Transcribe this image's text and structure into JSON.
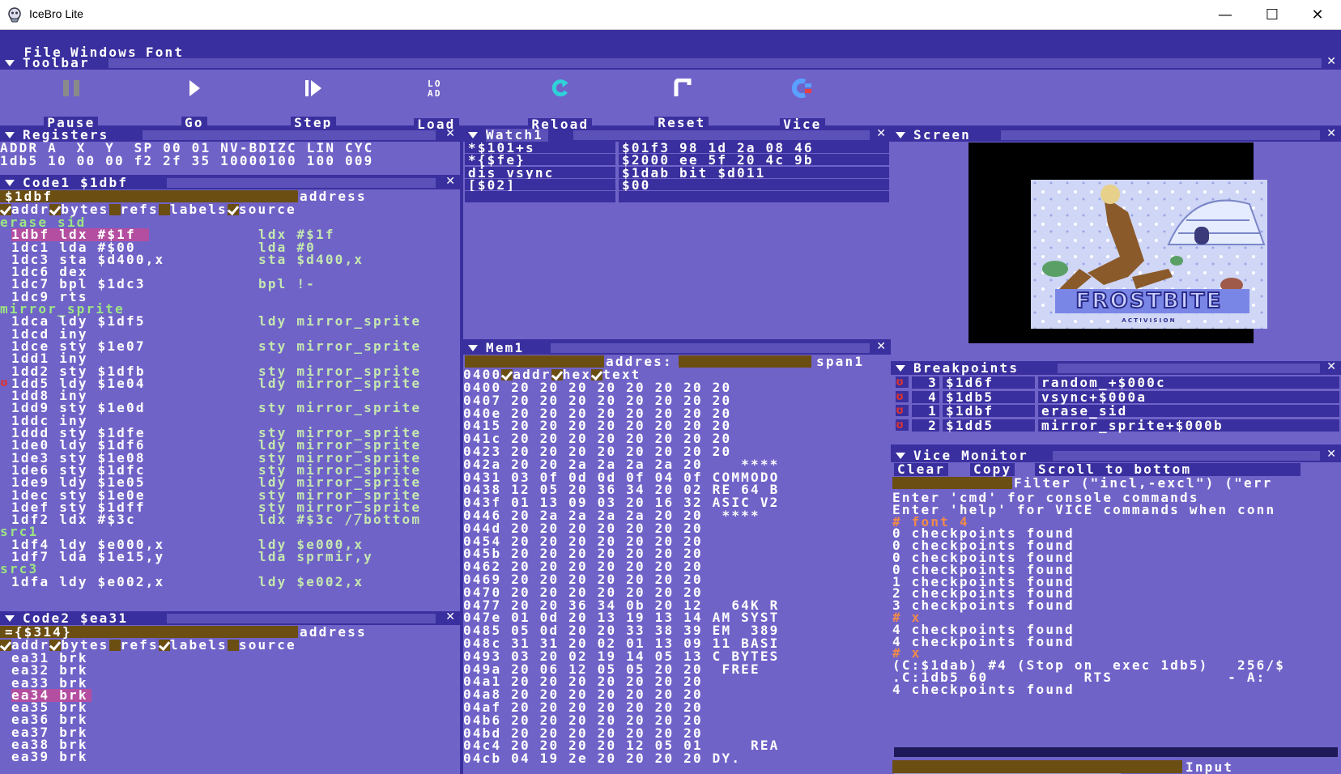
{
  "window": {
    "title": "IceBro Lite",
    "minimize": "—",
    "maximize": "☐",
    "close": "✕"
  },
  "menu": [
    "File",
    "Windows",
    "Font"
  ],
  "toolbar": {
    "title": "Toolbar",
    "buttons": [
      "Pause",
      "Go",
      "Step",
      "Load",
      "Reload",
      "Reset",
      "Vice"
    ]
  },
  "registers": {
    "title": "Registers",
    "header": "ADDR A  X  Y  SP 00 01 NV-BDIZC LIN CYC",
    "values": "1db5 10 00 00 f2 2f 35 10000100 100 009"
  },
  "code1": {
    "title": "Code1 $1dbf",
    "address_input": "$1dbf",
    "address_label": "address",
    "options": [
      {
        "label": "addr",
        "checked": true
      },
      {
        "label": "bytes",
        "checked": true
      },
      {
        "label": "refs",
        "checked": false
      },
      {
        "label": "labels",
        "checked": false
      },
      {
        "label": "source",
        "checked": true
      }
    ],
    "lines": [
      {
        "t": "label",
        "text": "erase_sid"
      },
      {
        "t": "pc",
        "addr": "1dbf",
        "ins": "ldx #$1f",
        "src": "ldx #$1f"
      },
      {
        "addr": "1dc1",
        "ins": "lda #$00",
        "src": "lda #0"
      },
      {
        "addr": "1dc3",
        "ins": "sta $d400,x",
        "src": "sta $d400,x"
      },
      {
        "addr": "1dc6",
        "ins": "dex",
        "src": ""
      },
      {
        "addr": "1dc7",
        "ins": "bpl $1dc3",
        "src": "bpl !-"
      },
      {
        "addr": "1dc9",
        "ins": "rts",
        "src": ""
      },
      {
        "t": "label",
        "text": "mirror_sprite"
      },
      {
        "addr": "1dca",
        "ins": "ldy $1df5",
        "src": "ldy mirror_sprite"
      },
      {
        "addr": "1dcd",
        "ins": "iny",
        "src": ""
      },
      {
        "addr": "1dce",
        "ins": "sty $1e07",
        "src": "sty mirror_sprite"
      },
      {
        "addr": "1dd1",
        "ins": "iny",
        "src": ""
      },
      {
        "addr": "1dd2",
        "ins": "sty $1dfb",
        "src": "sty mirror_sprite"
      },
      {
        "t": "bp",
        "addr": "1dd5",
        "ins": "ldy $1e04",
        "src": "ldy mirror_sprite"
      },
      {
        "addr": "1dd8",
        "ins": "iny",
        "src": ""
      },
      {
        "addr": "1dd9",
        "ins": "sty $1e0d",
        "src": "sty mirror_sprite"
      },
      {
        "addr": "1ddc",
        "ins": "iny",
        "src": ""
      },
      {
        "addr": "1ddd",
        "ins": "sty $1dfe",
        "src": "sty mirror_sprite"
      },
      {
        "addr": "1de0",
        "ins": "ldy $1df6",
        "src": "ldy mirror_sprite"
      },
      {
        "addr": "1de3",
        "ins": "sty $1e08",
        "src": "sty mirror_sprite"
      },
      {
        "addr": "1de6",
        "ins": "sty $1dfc",
        "src": "sty mirror_sprite"
      },
      {
        "addr": "1de9",
        "ins": "ldy $1e05",
        "src": "ldy mirror_sprite"
      },
      {
        "addr": "1dec",
        "ins": "sty $1e0e",
        "src": "sty mirror_sprite"
      },
      {
        "addr": "1def",
        "ins": "sty $1dff",
        "src": "sty mirror_sprite"
      },
      {
        "addr": "1df2",
        "ins": "ldx #$3c",
        "src": "ldx #$3c //bottom"
      },
      {
        "t": "label",
        "text": "src1"
      },
      {
        "addr": "1df4",
        "ins": "ldy $e000,x",
        "src": "ldy $e000,x"
      },
      {
        "addr": "1df7",
        "ins": "lda $1e15,y",
        "src": "lda sprmir,y"
      },
      {
        "t": "label",
        "text": "src3"
      },
      {
        "addr": "1dfa",
        "ins": "ldy $e002,x",
        "src": "ldy $e002,x"
      }
    ]
  },
  "code2": {
    "title": "Code2 $ea31",
    "address_input": "={$314}",
    "address_label": "address",
    "options": [
      {
        "label": "addr",
        "checked": true
      },
      {
        "label": "bytes",
        "checked": true
      },
      {
        "label": "refs",
        "checked": false
      },
      {
        "label": "labels",
        "checked": true
      },
      {
        "label": "source",
        "checked": false
      }
    ],
    "lines": [
      {
        "addr": "ea31",
        "ins": "brk"
      },
      {
        "addr": "ea32",
        "ins": "brk"
      },
      {
        "addr": "ea33",
        "ins": "brk"
      },
      {
        "t": "pc",
        "addr": "ea34",
        "ins": "brk"
      },
      {
        "addr": "ea35",
        "ins": "brk"
      },
      {
        "addr": "ea36",
        "ins": "brk"
      },
      {
        "addr": "ea37",
        "ins": "brk"
      },
      {
        "addr": "ea38",
        "ins": "brk"
      },
      {
        "addr": "ea39",
        "ins": "brk"
      }
    ]
  },
  "watch": {
    "title": "Watch1",
    "rows": [
      {
        "expr": "*$101+s",
        "value": "$01f3 98 1d 2a 08 46"
      },
      {
        "expr": "*{$fe}",
        "value": "$2000 ee 5f 20 4c 9b"
      },
      {
        "expr": "dis vsync",
        "value": "$1dab bit $d011"
      },
      {
        "expr": "[$02]",
        "value": "$00"
      },
      {
        "expr": "",
        "value": ""
      }
    ]
  },
  "mem": {
    "title": "Mem1",
    "address_label": "addres:",
    "span_label": "span1",
    "start": "0400",
    "options": [
      {
        "label": "addr",
        "checked": true
      },
      {
        "label": "hex",
        "checked": true
      },
      {
        "label": "text",
        "checked": true
      }
    ],
    "rows": [
      "0400 20 20 20 20 20 20 20 20",
      "0407 20 20 20 20 20 20 20 20",
      "040e 20 20 20 20 20 20 20 20",
      "0415 20 20 20 20 20 20 20 20",
      "041c 20 20 20 20 20 20 20 20",
      "0423 20 20 20 20 20 20 20 20",
      "042a 20 20 2a 2a 2a 2a 20    ****",
      "0431 03 0f 0d 0d 0f 04 0f COMMODO",
      "0438 12 05 20 36 34 20 02 RE 64 B",
      "043f 01 13 09 03 20 16 32 ASIC V2",
      "0446 20 2a 2a 2a 2a 20 20  ****",
      "044d 20 20 20 20 20 20 20",
      "0454 20 20 20 20 20 20 20",
      "045b 20 20 20 20 20 20 20",
      "0462 20 20 20 20 20 20 20",
      "0469 20 20 20 20 20 20 20",
      "0470 20 20 20 20 20 20 20",
      "0477 20 20 36 34 0b 20 12   64K R",
      "047e 01 0d 20 13 19 13 14 AM SYST",
      "0485 05 0d 20 20 33 38 39 EM  389",
      "048c 31 31 20 02 01 13 09 11 BASI",
      "0493 03 20 02 19 14 05 13 C BYTES",
      "049a 20 06 12 05 05 20 20  FREE",
      "04a1 20 20 20 20 20 20 20",
      "04a8 20 20 20 20 20 20 20",
      "04af 20 20 20 20 20 20 20",
      "04b6 20 20 20 20 20 20 20",
      "04bd 20 20 20 20 20 20 20",
      "04c4 20 20 20 20 12 05 01     REA",
      "04cb 04 19 2e 20 20 20 20 DY."
    ]
  },
  "screen": {
    "title": "Screen",
    "game_title": "FROSTBITE",
    "publisher": "ACTIVISION"
  },
  "breakpoints": {
    "title": "Breakpoints",
    "rows": [
      {
        "num": "3",
        "addr": "$1d6f",
        "label": "random_+$000c"
      },
      {
        "num": "4",
        "addr": "$1db5",
        "label": "vsync+$000a"
      },
      {
        "num": "1",
        "addr": "$1dbf",
        "label": "erase_sid"
      },
      {
        "num": "2",
        "addr": "$1dd5",
        "label": "mirror_sprite+$000b"
      }
    ]
  },
  "monitor": {
    "title": "Vice Monitor",
    "buttons": [
      "Clear",
      "Copy",
      "Scroll to bottom"
    ],
    "filter": "Filter (\"incl,-excl\") (\"err",
    "lines": [
      {
        "c": "w",
        "text": "Enter 'cmd' for console commands"
      },
      {
        "c": "w",
        "text": "Enter 'help' for VICE commands when conn"
      },
      {
        "c": "o",
        "text": "# font 4"
      },
      {
        "c": "w",
        "text": "0 checkpoints found"
      },
      {
        "c": "w",
        "text": "0 checkpoints found"
      },
      {
        "c": "w",
        "text": "0 checkpoints found"
      },
      {
        "c": "w",
        "text": "0 checkpoints found"
      },
      {
        "c": "w",
        "text": "1 checkpoints found"
      },
      {
        "c": "w",
        "text": "2 checkpoints found"
      },
      {
        "c": "w",
        "text": "3 checkpoints found"
      },
      {
        "c": "o",
        "text": "# x"
      },
      {
        "c": "w",
        "text": "4 checkpoints found"
      },
      {
        "c": "w",
        "text": "4 checkpoints found"
      },
      {
        "c": "o",
        "text": "# x"
      },
      {
        "c": "w",
        "text": "(C:$1dab) #4 (Stop on  exec 1db5)   256/$"
      },
      {
        "c": "w",
        "text": ".C:1db5 60          RTS            - A:"
      },
      {
        "c": "w",
        "text": "4 checkpoints found"
      }
    ],
    "input_label": "Input"
  }
}
